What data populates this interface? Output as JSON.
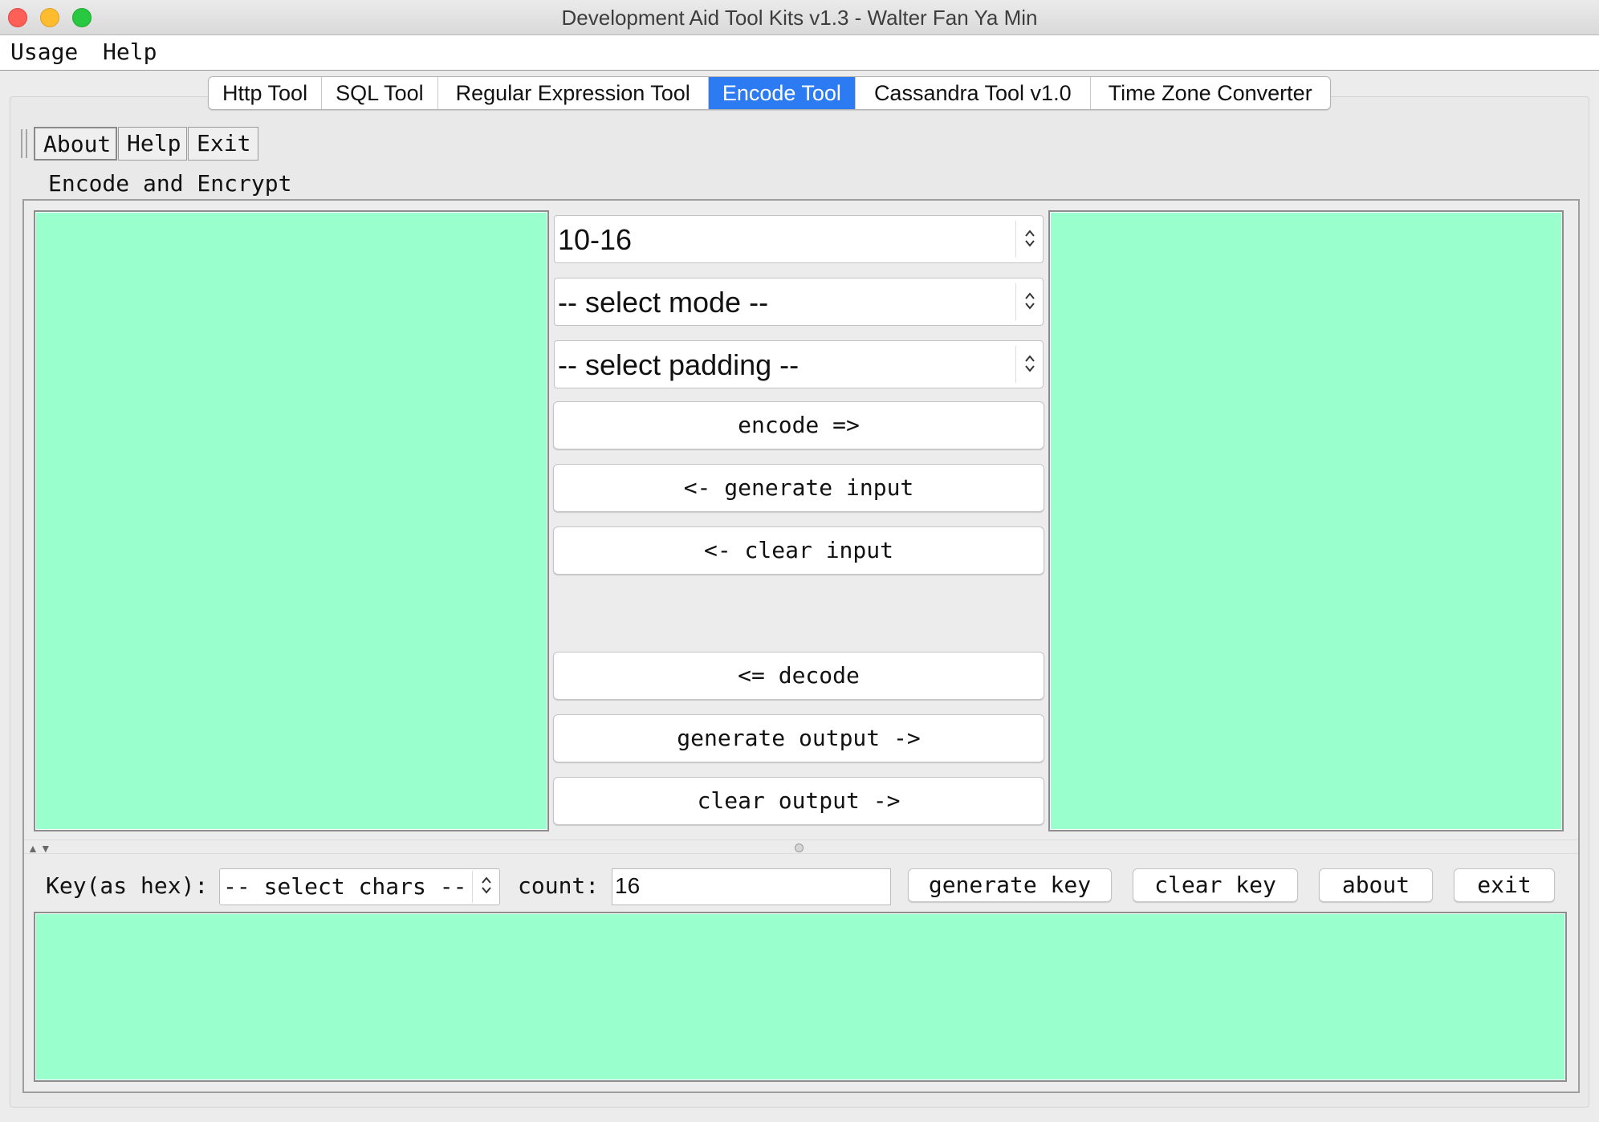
{
  "window": {
    "title": "Development Aid Tool Kits v1.3 - Walter Fan Ya Min"
  },
  "menubar": {
    "items": [
      {
        "label": "Usage"
      },
      {
        "label": "Help"
      }
    ]
  },
  "tabs": [
    {
      "label": "Http Tool",
      "active": false
    },
    {
      "label": "SQL Tool",
      "active": false
    },
    {
      "label": "Regular Expression Tool",
      "active": false
    },
    {
      "label": "Encode Tool",
      "active": true
    },
    {
      "label": "Cassandra Tool v1.0",
      "active": false
    },
    {
      "label": "Time Zone Converter",
      "active": false
    }
  ],
  "toolbar": {
    "about": "About",
    "help": "Help",
    "exit": "Exit"
  },
  "section": {
    "title": "Encode and Encrypt"
  },
  "encoder": {
    "input_text": "",
    "output_text": "",
    "conversion_select": "10-16",
    "mode_select": "-- select mode --",
    "padding_select": "-- select padding --",
    "buttons": {
      "encode": "encode =>",
      "generate_input": "<- generate input",
      "clear_input": "<- clear input",
      "decode": "<= decode",
      "generate_output": "generate output ->",
      "clear_output": "clear output ->"
    }
  },
  "key": {
    "label": "Key(as hex):",
    "chars_select": "-- select chars --",
    "count_label": "count:",
    "count_value": "16",
    "generate_key": "generate key",
    "clear_key": "clear key",
    "about": "about",
    "exit": "exit",
    "key_text": ""
  },
  "colors": {
    "textarea_bg": "#99ffcc",
    "active_tab": "#2d7bf3"
  }
}
